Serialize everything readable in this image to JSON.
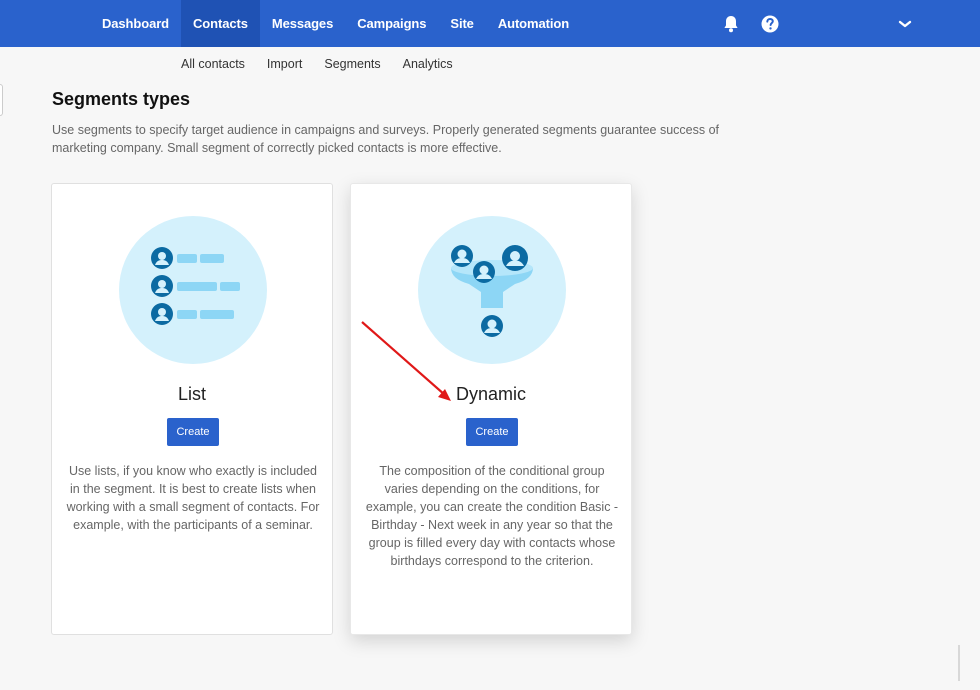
{
  "nav": {
    "items": [
      {
        "label": "Dashboard",
        "active": false
      },
      {
        "label": "Contacts",
        "active": true
      },
      {
        "label": "Messages",
        "active": false
      },
      {
        "label": "Campaigns",
        "active": false
      },
      {
        "label": "Site",
        "active": false
      },
      {
        "label": "Automation",
        "active": false
      }
    ],
    "icons": [
      "bell-icon",
      "help-icon",
      "chevron-down-icon"
    ]
  },
  "subnav": {
    "items": [
      "All contacts",
      "Import",
      "Segments",
      "Analytics"
    ]
  },
  "page": {
    "title": "Segments types",
    "description": "Use segments to specify target audience in campaigns and surveys. Properly generated segments guarantee success of marketing company. Small segment of correctly picked contacts is more effective."
  },
  "cards": [
    {
      "title": "List",
      "button": "Create",
      "description": "Use lists, if you know who exactly is included in the segment. It is best to create lists when working with a small segment of contacts. For example, with the participants of a seminar.",
      "icon": "contact-list-icon"
    },
    {
      "title": "Dynamic",
      "button": "Create",
      "description": "The composition of the conditional group varies depending on the conditions, for example, you can create the condition Basic - Birthday - Next week in any year so that the group is filled every day with contacts whose birthdays correspond to the criterion.",
      "icon": "contacts-funnel-icon"
    }
  ],
  "colors": {
    "brand": "#2a62cc",
    "brand_active": "#1f52b4",
    "illustration_bg": "#d4f1fc",
    "illustration_dark": "#0b6aa2",
    "illustration_light": "#8dd6f5",
    "annotation_arrow": "#e01818"
  }
}
